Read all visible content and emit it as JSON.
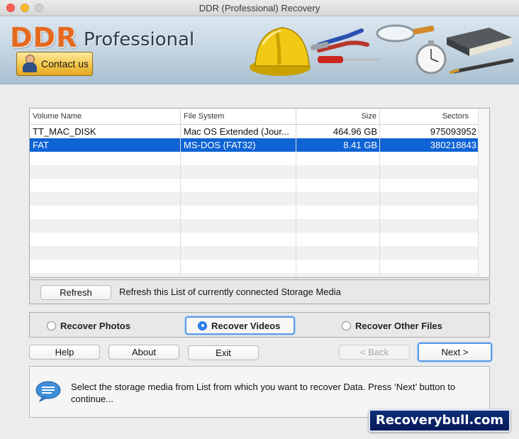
{
  "window": {
    "title": "DDR (Professional) Recovery"
  },
  "banner": {
    "brand": "DDR",
    "brand_sub": "Professional",
    "contact_label": "Contact us"
  },
  "table": {
    "columns": [
      "Volume Name",
      "File System",
      "Size",
      "Sectors"
    ],
    "rows": [
      {
        "volume": "TT_MAC_DISK",
        "fs": "Mac OS Extended (Jour...",
        "size": "464.96  GB",
        "sectors": "975093952",
        "selected": false
      },
      {
        "volume": "FAT",
        "fs": "MS-DOS (FAT32)",
        "size": "8.41  GB",
        "sectors": "380218843",
        "selected": true
      }
    ],
    "empty_rows": 10
  },
  "refresh": {
    "button": "Refresh",
    "text": "Refresh this List of currently connected Storage Media"
  },
  "modes": {
    "photos": "Recover Photos",
    "videos": "Recover Videos",
    "other": "Recover Other Files",
    "selected": "videos"
  },
  "buttons": {
    "help": "Help",
    "about": "About",
    "exit": "Exit",
    "back": "< Back",
    "next": "Next >"
  },
  "info": {
    "message": "Select the storage media from List from which you want to recover Data. Press ‘Next’ button to continue..."
  },
  "watermark": "Recoverybull.com",
  "colors": {
    "selection": "#0f63d4",
    "brand": "#e56a1e",
    "default_button_ring": "#5b9be6"
  }
}
